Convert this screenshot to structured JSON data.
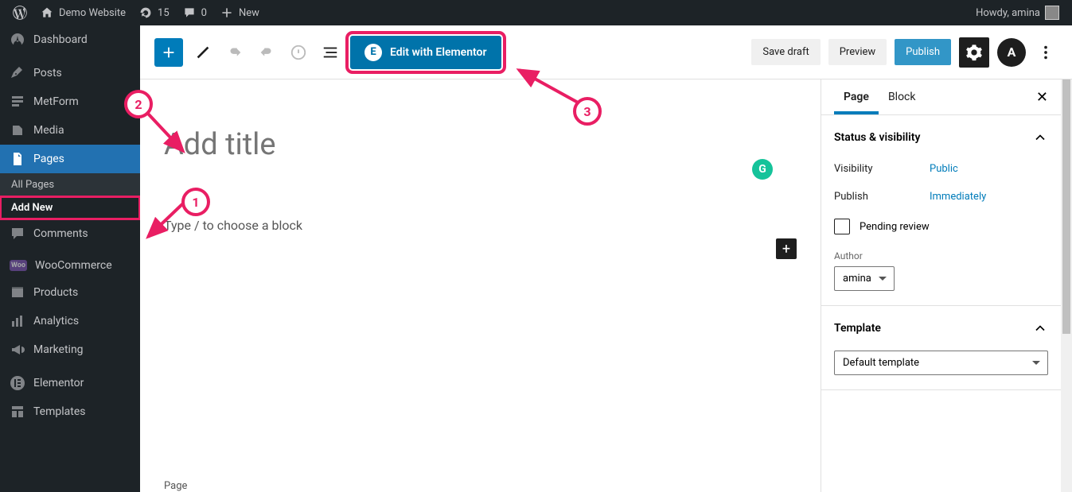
{
  "adminbar": {
    "site_name": "Demo Website",
    "update_count": "15",
    "comment_count": "0",
    "new_label": "New",
    "howdy": "Howdy, amina"
  },
  "sidebar": {
    "items": [
      {
        "label": "Dashboard",
        "icon": "dashboard"
      },
      {
        "label": "Posts",
        "icon": "pin"
      },
      {
        "label": "MetForm",
        "icon": "metform"
      },
      {
        "label": "Media",
        "icon": "media"
      },
      {
        "label": "Pages",
        "icon": "pages",
        "active": true
      },
      {
        "label": "Comments",
        "icon": "comments"
      },
      {
        "label": "WooCommerce",
        "icon": "woo"
      },
      {
        "label": "Products",
        "icon": "products"
      },
      {
        "label": "Analytics",
        "icon": "analytics"
      },
      {
        "label": "Marketing",
        "icon": "marketing"
      },
      {
        "label": "Elementor",
        "icon": "elementor"
      },
      {
        "label": "Templates",
        "icon": "templates"
      }
    ],
    "submenu": {
      "all_pages": "All Pages",
      "add_new": "Add New"
    }
  },
  "toolbar": {
    "elementor_label": "Edit with Elementor",
    "save_draft": "Save draft",
    "preview": "Preview",
    "publish": "Publish",
    "astra": "A"
  },
  "editor": {
    "title_placeholder": "Add title",
    "block_placeholder": "Type / to choose a block",
    "footer_breadcrumb": "Page",
    "grammarly": "G"
  },
  "inspector": {
    "tabs": {
      "page": "Page",
      "block": "Block"
    },
    "panels": {
      "status": {
        "title": "Status & visibility",
        "visibility_label": "Visibility",
        "visibility_value": "Public",
        "publish_label": "Publish",
        "publish_value": "Immediately",
        "pending_review": "Pending review",
        "author_label": "Author",
        "author_value": "amina"
      },
      "template": {
        "title": "Template",
        "value": "Default template"
      }
    }
  },
  "annotations": {
    "n1": "1",
    "n2": "2",
    "n3": "3"
  }
}
